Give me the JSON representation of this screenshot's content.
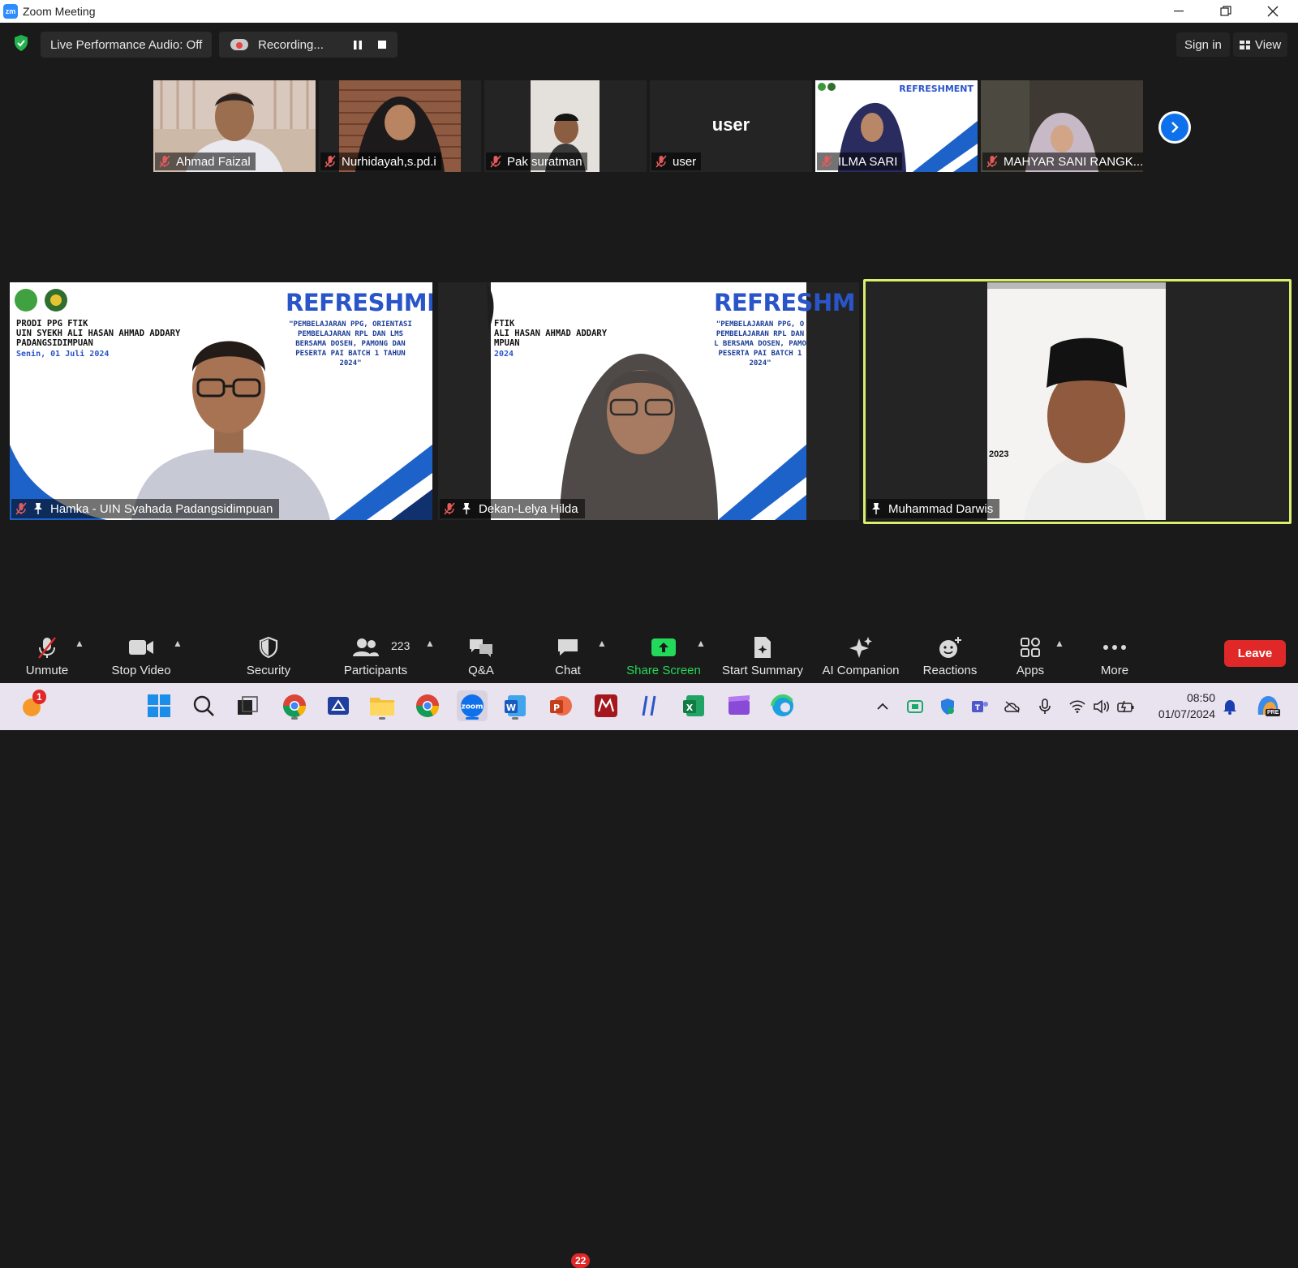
{
  "window": {
    "title": "Zoom Meeting",
    "logo_text": "zm"
  },
  "topbar": {
    "live_audio_label": "Live Performance Audio: Off",
    "recording_label": "Recording...",
    "sign_in_label": "Sign in",
    "view_label": "View"
  },
  "thumbnails": [
    {
      "name": "Ahmad Faizal",
      "muted": true
    },
    {
      "name": "Nurhidayah,s.pd.i",
      "muted": true
    },
    {
      "name": "Pak suratman",
      "muted": true
    },
    {
      "name": "user",
      "muted": true,
      "placeholder_text": "user"
    },
    {
      "name": "ILMA SARI",
      "muted": true
    },
    {
      "name": "MAHYAR SANI RANGK...",
      "muted": true
    }
  ],
  "tiles": [
    {
      "name": "Hamka - UIN Syahada Padangsidimpuan",
      "muted": true,
      "pinned": true,
      "banner": {
        "title": "REFRESHMENT",
        "subtitle": "\"PEMBELAJARAN PPG, ORIENTASI PEMBELAJARAN RPL DAN LMS BERSAMA DOSEN, PAMONG DAN PESERTA PAI BATCH 1 TAHUN 2024\"",
        "prodi": "PRODI PPG FTIK\nUIN SYEKH ALI HASAN AHMAD ADDARY\nPADANGSIDIMPUAN",
        "date": "Senin, 01 Juli 2024"
      }
    },
    {
      "name": "Dekan-Lelya Hilda",
      "muted": true,
      "pinned": true,
      "banner": {
        "title": "REFRESHM",
        "subtitle": "\"PEMBELAJARAN PPG, O PEMBELAJARAN RPL DAN L BERSAMA DOSEN, PAMO PESERTA PAI BATCH 1 2024\"",
        "prodi": "FTIK\nALI HASAN AHMAD ADDARY\nMPUAN",
        "date": "2024"
      }
    },
    {
      "name": "Muhammad Darwis",
      "muted": false,
      "pinned": true,
      "active_speaker": true,
      "overlay_text": "2023"
    }
  ],
  "toolbar": {
    "unmute": "Unmute",
    "stop_video": "Stop Video",
    "security": "Security",
    "participants": "Participants",
    "participants_count": "223",
    "qa": "Q&A",
    "chat": "Chat",
    "chat_badge": "22",
    "share_screen": "Share Screen",
    "start_summary": "Start Summary",
    "ai_companion": "AI Companion",
    "reactions": "Reactions",
    "apps": "Apps",
    "more": "More",
    "leave": "Leave"
  },
  "taskbar": {
    "notification_badge": "1",
    "time": "08:50",
    "date": "01/07/2024",
    "copilot_label": "PRE"
  },
  "colors": {
    "zoom_blue": "#0e71eb",
    "leave_red": "#e02828",
    "share_green": "#23d959",
    "active_speaker_border": "#d8ef6e",
    "banner_blue": "#2a55c9"
  }
}
